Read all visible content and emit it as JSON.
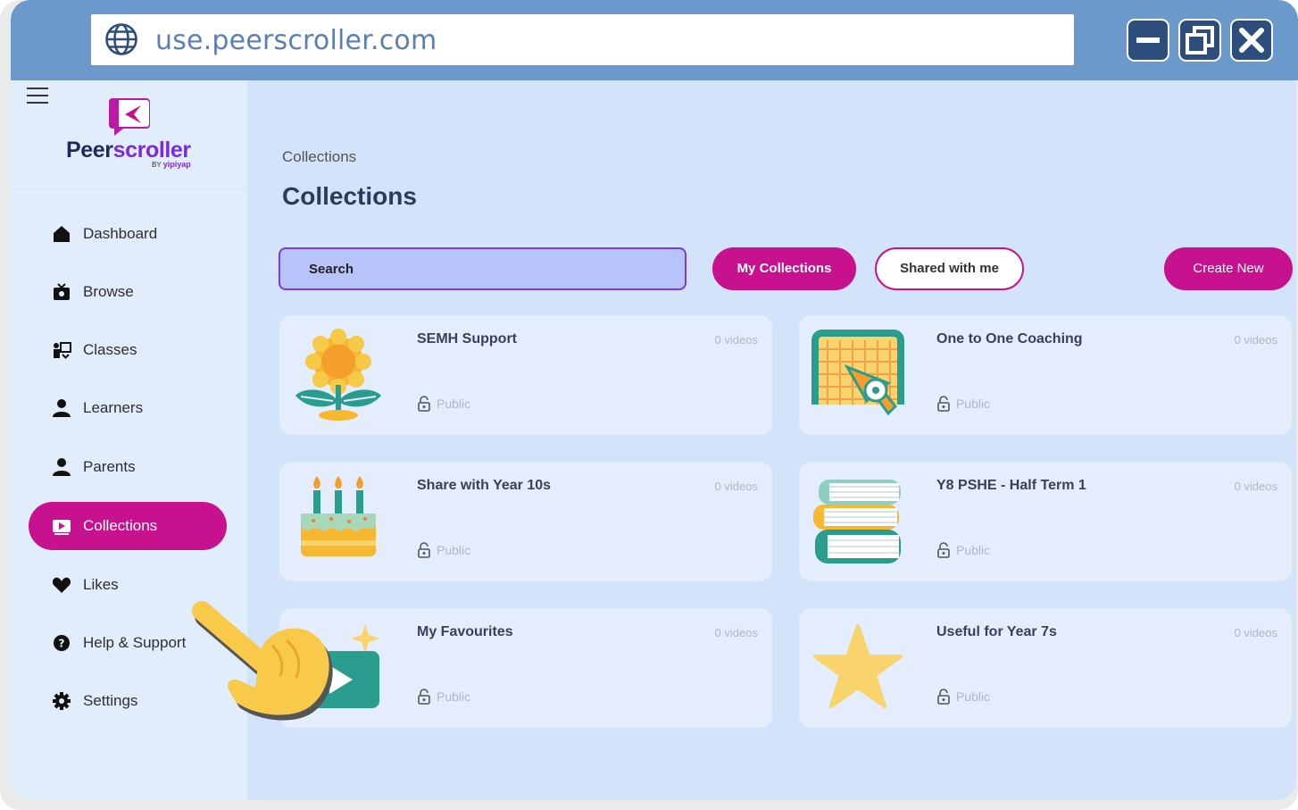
{
  "browser": {
    "url": "use.peerscroller.com",
    "icons": [
      "globe-icon",
      "minimize-icon",
      "restore-icon",
      "close-icon"
    ]
  },
  "logo": {
    "name_part1": "Peer",
    "name_part2": "scroller",
    "sub_by": "BY",
    "sub_brand": "yipiyap"
  },
  "nav": [
    {
      "label": "Dashboard",
      "icon": "home-icon"
    },
    {
      "label": "Browse",
      "icon": "tv-icon"
    },
    {
      "label": "Classes",
      "icon": "classroom-icon"
    },
    {
      "label": "Learners",
      "icon": "person-icon"
    },
    {
      "label": "Parents",
      "icon": "person-icon"
    },
    {
      "label": "Collections",
      "icon": "play-icon",
      "active": true
    },
    {
      "label": "Likes",
      "icon": "heart-icon"
    },
    {
      "label": "Help & Support",
      "icon": "help-icon"
    },
    {
      "label": "Settings",
      "icon": "gear-icon"
    }
  ],
  "page": {
    "breadcrumb": "Collections",
    "title": "Collections",
    "search_label": "Search",
    "filters": {
      "my_collections": "My Collections",
      "shared_with_me": "Shared with me"
    },
    "create_new": "Create New"
  },
  "collections": [
    {
      "title": "SEMH Support",
      "videos": "0 videos",
      "visibility": "Public",
      "icon": "sunflower-icon"
    },
    {
      "title": "One to One Coaching",
      "videos": "0 videos",
      "visibility": "Public",
      "icon": "football-goal-icon"
    },
    {
      "title": "Share with Year 10s",
      "videos": "0 videos",
      "visibility": "Public",
      "icon": "birthday-cake-icon"
    },
    {
      "title": "Y8 PSHE - Half Term 1",
      "videos": "0 videos",
      "visibility": "Public",
      "icon": "books-icon"
    },
    {
      "title": "My Favourites",
      "videos": "0 videos",
      "visibility": "Public",
      "icon": "video-play-icon"
    },
    {
      "title": "Useful for Year 7s",
      "videos": "0 videos",
      "visibility": "Public",
      "icon": "star-icon"
    }
  ],
  "colors": {
    "accent": "#c8118e",
    "titlebar": "#6c99cc",
    "background": "#d3e3fa",
    "sidebar": "#e2edfc"
  }
}
